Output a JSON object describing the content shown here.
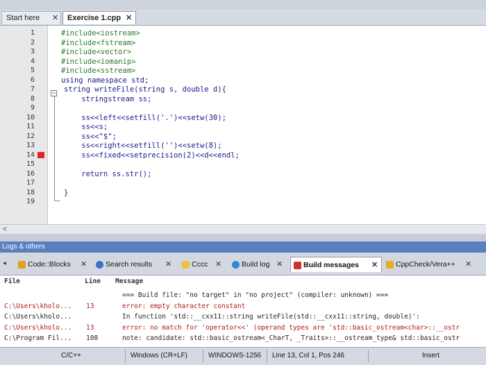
{
  "editor_tabs": [
    {
      "label": "Start here",
      "active": false
    },
    {
      "label": "Exercise 1.cpp",
      "active": true
    }
  ],
  "code_lines": [
    {
      "n": "1",
      "text": "#include<iostream>"
    },
    {
      "n": "2",
      "text": "#include<fstream>"
    },
    {
      "n": "3",
      "text": "#include<vector>"
    },
    {
      "n": "4",
      "text": "#include<iomanip>"
    },
    {
      "n": "5",
      "text": "#include<sstream>"
    },
    {
      "n": "6",
      "text": "using namespace std;"
    },
    {
      "n": "7",
      "text": "string writeFile(string s, double d){"
    },
    {
      "n": "8",
      "text": "    stringstream ss;"
    },
    {
      "n": "9",
      "text": ""
    },
    {
      "n": "10",
      "text": "    ss<<left<<setfill('.')<<setw(30);"
    },
    {
      "n": "11",
      "text": "    ss<<s;"
    },
    {
      "n": "12",
      "text": "    ss<<\"$\";"
    },
    {
      "n": "13",
      "text": "    ss<<right<<setfill('')<<setw(8);"
    },
    {
      "n": "14",
      "text": "    ss<<fixed<<setprecision(2)<<d<<endl;"
    },
    {
      "n": "15",
      "text": ""
    },
    {
      "n": "16",
      "text": "    return ss.str();"
    },
    {
      "n": "17",
      "text": ""
    },
    {
      "n": "18",
      "text": "}"
    },
    {
      "n": "19",
      "text": ""
    }
  ],
  "logs_panel": {
    "title": "Logs & others",
    "tabs": [
      {
        "label": "Code::Blocks",
        "active": false
      },
      {
        "label": "Search results",
        "active": false
      },
      {
        "label": "Cccc",
        "active": false
      },
      {
        "label": "Build log",
        "active": false
      },
      {
        "label": "Build messages",
        "active": true
      },
      {
        "label": "CppCheck/Vera++",
        "active": false
      }
    ],
    "columns": {
      "file": "File",
      "line": "Line",
      "message": "Message"
    },
    "rows": [
      {
        "file": "",
        "line": "",
        "message": "=== Build file: \"no target\" in \"no project\" (compiler: unknown) ===",
        "color": "#222222"
      },
      {
        "file": "C:\\Users\\kholo...",
        "line": "13",
        "message": "error: empty character constant",
        "color": "#b01818"
      },
      {
        "file": "C:\\Users\\kholo...",
        "line": "",
        "message": "In function 'std::__cxx11::string writeFile(std::__cxx11::string, double)':",
        "color": "#222222"
      },
      {
        "file": "C:\\Users\\kholo...",
        "line": "13",
        "message": "error: no match for 'operator<<' (operand types are 'std::basic_ostream<char>::__ostr",
        "color": "#b01818"
      },
      {
        "file": "C:\\Program Fil...",
        "line": "108",
        "message": "note: candidate: std::basic_ostream<_CharT, _Traits>::__ostream_type& std::basic_ostr",
        "color": "#222222"
      }
    ]
  },
  "statusbar": {
    "language": "C/C++",
    "eol": "Windows (CR+LF)",
    "encoding": "WINDOWS-1256",
    "position": "Line 13, Col 1, Pos 246",
    "mode": "Insert"
  },
  "colors": {
    "breakpoint": "#d62a2a",
    "logs_header": "#5a7fc0",
    "error_text": "#b01818"
  }
}
